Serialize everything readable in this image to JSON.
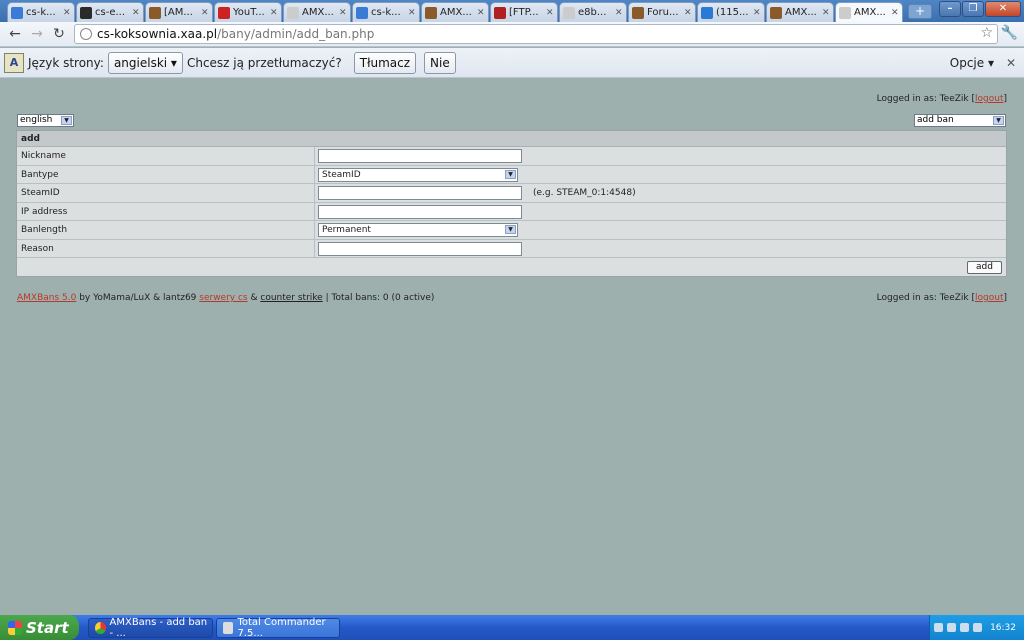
{
  "browser": {
    "tabs": [
      {
        "label": "cs-k...",
        "icon": "home-icon",
        "color": "#3a7bd5",
        "active": false
      },
      {
        "label": "cs-e...",
        "icon": "site-icon",
        "color": "#2a2a2a",
        "active": false
      },
      {
        "label": "[AM...",
        "icon": "soldier-icon",
        "color": "#8a5a2a",
        "active": false
      },
      {
        "label": "YouT...",
        "icon": "youtube-icon",
        "color": "#cc2222",
        "active": false
      },
      {
        "label": "AMX...",
        "icon": "page-icon",
        "color": "#cccccc",
        "active": false
      },
      {
        "label": "cs-k...",
        "icon": "home-icon",
        "color": "#3a7bd5",
        "active": false
      },
      {
        "label": "AMX...",
        "icon": "soldier-icon",
        "color": "#8a5a2a",
        "active": false
      },
      {
        "label": "[FTP...",
        "icon": "ftp-icon",
        "color": "#b02020",
        "active": false
      },
      {
        "label": "e8b...",
        "icon": "page-icon",
        "color": "#cccccc",
        "active": false
      },
      {
        "label": "Foru...",
        "icon": "soldier-icon",
        "color": "#8a5a2a",
        "active": false
      },
      {
        "label": "(115...",
        "icon": "chat-icon",
        "color": "#2a7ad5",
        "active": false
      },
      {
        "label": "AMX...",
        "icon": "soldier-icon",
        "color": "#8a5a2a",
        "active": false
      },
      {
        "label": "AMX...",
        "icon": "page-icon",
        "color": "#cccccc",
        "active": true
      }
    ],
    "url_host": "cs-koksownia.xaa.pl",
    "url_path": "/bany/admin/add_ban.php"
  },
  "translate_bar": {
    "lang_label": "Język strony:",
    "lang_value": "angielski",
    "question": "Chcesz ją przetłumaczyć?",
    "translate_btn": "Tłumacz",
    "no_btn": "Nie",
    "options": "Opcje"
  },
  "page": {
    "logged_in_prefix": "Logged in as: TeeZik [",
    "logout": "logout",
    "logged_in_suffix": "]",
    "language_select": "english",
    "action_select": "add ban",
    "form_title": "add",
    "rows": [
      {
        "label": "Nickname",
        "value": "",
        "type": "input",
        "hint": ""
      },
      {
        "label": "Bantype",
        "value": "SteamID",
        "type": "select",
        "hint": ""
      },
      {
        "label": "SteamID",
        "value": "",
        "type": "input",
        "hint": "(e.g. STEAM_0:1:4548)"
      },
      {
        "label": "IP address",
        "value": "",
        "type": "input",
        "hint": ""
      },
      {
        "label": "Banlength",
        "value": "Permanent",
        "type": "select",
        "hint": ""
      },
      {
        "label": "Reason",
        "value": "",
        "type": "input",
        "hint": ""
      }
    ],
    "add_button": "add",
    "footer": {
      "amxbans_link": "AMXBans 5.0",
      "by": " by YoMama/LuX & lantz69 ",
      "servers_link": "serwery cs",
      "amp": " & ",
      "cs_link": "counter strike",
      "total": " | Total bans: 0 (0 active)"
    }
  },
  "taskbar": {
    "start": "Start",
    "tasks": [
      "AMXBans - add ban - ...",
      "Total Commander 7.5..."
    ],
    "clock": "16:32"
  }
}
